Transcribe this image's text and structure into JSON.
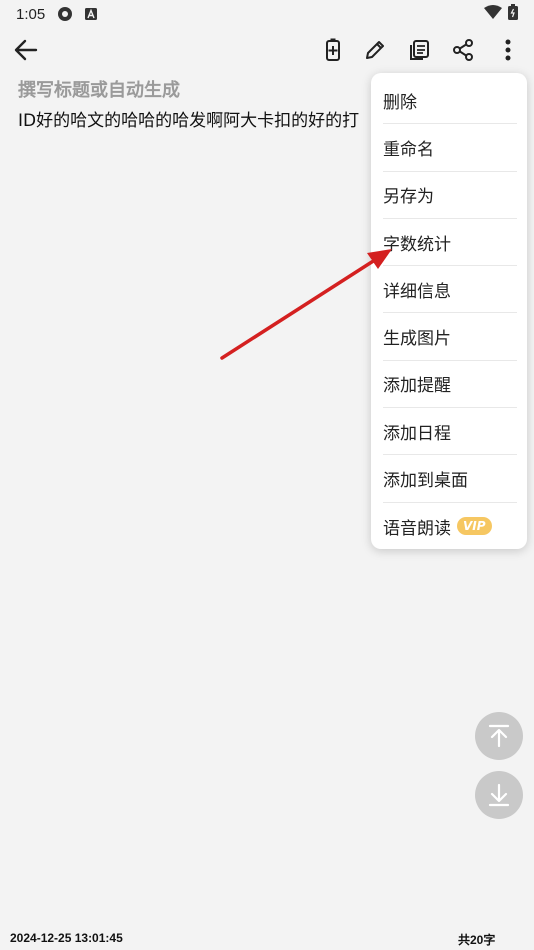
{
  "status_bar": {
    "time": "1:05"
  },
  "editor": {
    "title_placeholder": "撰写标题或自动生成",
    "content": "ID好的哈文的哈哈的哈发啊阿大卡扣的好的打"
  },
  "menu": {
    "items": [
      {
        "label": "删除"
      },
      {
        "label": "重命名"
      },
      {
        "label": "另存为"
      },
      {
        "label": "字数统计"
      },
      {
        "label": "详细信息"
      },
      {
        "label": "生成图片"
      },
      {
        "label": "添加提醒"
      },
      {
        "label": "添加日程"
      },
      {
        "label": "添加到桌面"
      },
      {
        "label": "语音朗读",
        "badge": "VIP"
      }
    ]
  },
  "footer": {
    "timestamp": "2024-12-25 13:01:45",
    "char_count": "共20字"
  },
  "colors": {
    "annotation_arrow": "#d42020",
    "vip_badge": "#f6c762"
  }
}
